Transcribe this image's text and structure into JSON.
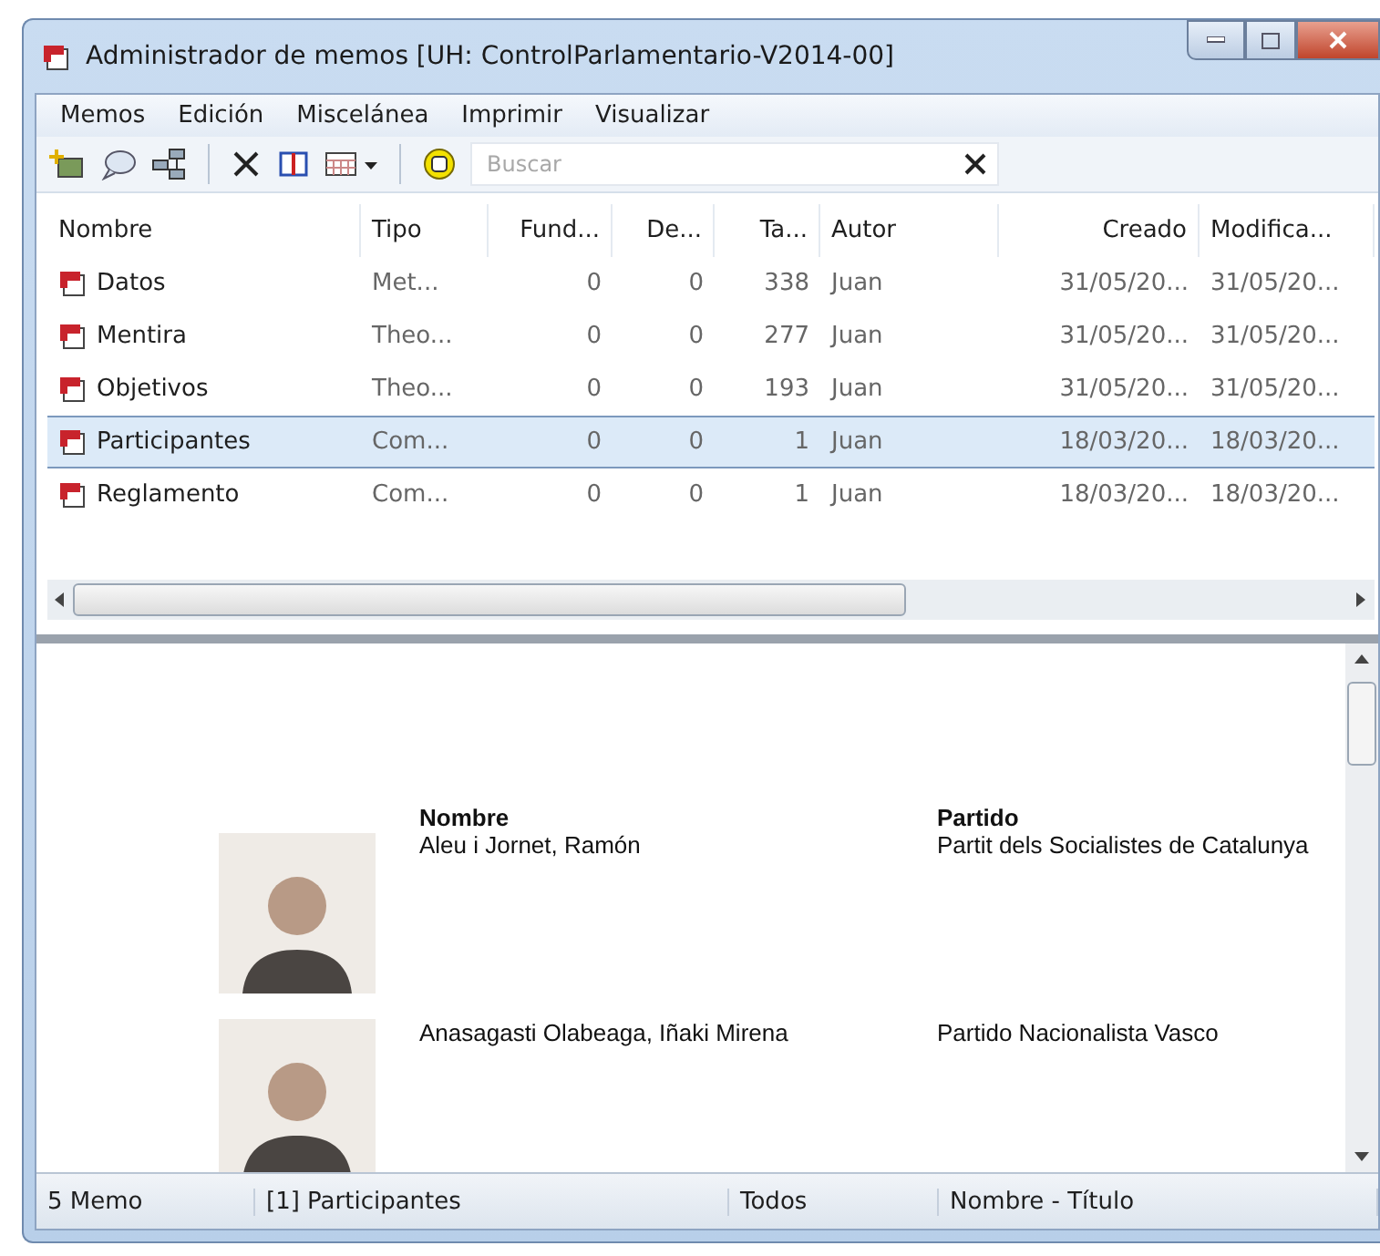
{
  "window": {
    "title": "Administrador de memos [UH: ControlParlamentario-V2014-00]"
  },
  "menu": [
    "Memos",
    "Edición",
    "Miscelánea",
    "Imprimir",
    "Visualizar"
  ],
  "search": {
    "placeholder": "Buscar"
  },
  "table": {
    "columns": [
      "Nombre",
      "Tipo",
      "Fund...",
      "De...",
      "Ta...",
      "Autor",
      "Creado",
      "Modifica..."
    ],
    "rows": [
      {
        "selected": false,
        "cells": [
          "Datos",
          "Met...",
          "0",
          "0",
          "338",
          "Juan",
          "31/05/20...",
          "31/05/20..."
        ]
      },
      {
        "selected": false,
        "cells": [
          "Mentira",
          "Theo...",
          "0",
          "0",
          "277",
          "Juan",
          "31/05/20...",
          "31/05/20..."
        ]
      },
      {
        "selected": false,
        "cells": [
          "Objetivos",
          "Theo...",
          "0",
          "0",
          "193",
          "Juan",
          "31/05/20...",
          "31/05/20..."
        ]
      },
      {
        "selected": true,
        "cells": [
          "Participantes",
          "Com...",
          "0",
          "0",
          "1",
          "Juan",
          "18/03/20...",
          "18/03/20..."
        ]
      },
      {
        "selected": false,
        "cells": [
          "Reglamento",
          "Com...",
          "0",
          "0",
          "1",
          "Juan",
          "18/03/20...",
          "18/03/20..."
        ]
      }
    ]
  },
  "preview": {
    "headers": [
      "Nombre",
      "Partido"
    ],
    "people": [
      {
        "name": "Aleu i Jornet, Ramón",
        "party": "Partit dels Socialistes de Catalunya"
      },
      {
        "name": "Anasagasti Olabeaga, Iñaki Mirena",
        "party": "Partido Nacionalista Vasco"
      }
    ]
  },
  "status_bar": [
    "5 Memo",
    "[1] Participantes",
    "Todos",
    "Nombre - Título"
  ]
}
